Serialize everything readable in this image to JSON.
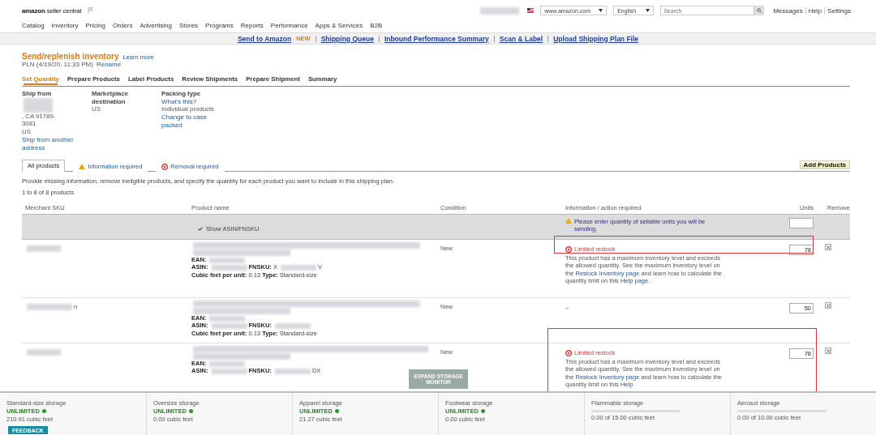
{
  "header": {
    "logo": {
      "brand": "amazon",
      "product": "seller central"
    },
    "marketplace": "www.amazon.com",
    "language": "English",
    "search_placeholder": "Search",
    "links": [
      "Messages",
      "Help",
      "Settings"
    ]
  },
  "nav": [
    "Catalog",
    "Inventory",
    "Pricing",
    "Orders",
    "Advertising",
    "Stores",
    "Programs",
    "Reports",
    "Performance",
    "Apps & Services",
    "B2B"
  ],
  "subnav": [
    {
      "label": "Send to Amazon",
      "badge": "NEW"
    },
    {
      "label": "Shipping Queue"
    },
    {
      "label": "Inbound Performance Summary"
    },
    {
      "label": "Scan & Label"
    },
    {
      "label": "Upload Shipping Plan File"
    }
  ],
  "page": {
    "title": "Send/replenish inventory",
    "learn_more": "Learn more",
    "plan": "PLN (4/19/20, 11:33 PM)",
    "rename": "Rename"
  },
  "steps": [
    {
      "label": "Set Quantity",
      "selected": true
    },
    {
      "label": "Prepare Products",
      "selected": false
    },
    {
      "label": "Label Products",
      "selected": false
    },
    {
      "label": "Review Shipments",
      "selected": false
    },
    {
      "label": "Prepare Shipment",
      "selected": false
    },
    {
      "label": "Summary",
      "selected": false
    }
  ],
  "ship_from": {
    "label": "Ship from",
    "address": [
      ", CA 91789-",
      "3081",
      "US"
    ],
    "link": "Ship from another address"
  },
  "marketplace": {
    "label": "Marketplace destination",
    "value": "US"
  },
  "packing": {
    "label": "Packing type",
    "help": "What's this?",
    "value": "Individual products",
    "link": "Change to case packed"
  },
  "filter_tabs": [
    {
      "label": "All products",
      "kind": "all",
      "selected": true
    },
    {
      "label": "Information required",
      "kind": "warning",
      "selected": false
    },
    {
      "label": "Removal required",
      "kind": "error",
      "selected": false
    }
  ],
  "add_button": "Add Products",
  "instructions": "Provide missing information, remove ineligible products, and specify the quantity for each product you want to include in this shipping plan.",
  "count": "1 to 8 of 8 products",
  "table": {
    "columns": [
      "Merchant SKU",
      "Product name",
      "Condition",
      "Information / action required",
      "Units",
      "Remove"
    ],
    "summary_row": {
      "toggle": "Show ASIN/FNSKU",
      "message": "Please enter quantity of sellable units you will be sending."
    },
    "rows": [
      {
        "condition": "New",
        "lines": [
          [
            {
              "kind": "label",
              "text": "EAN:"
            },
            {
              "kind": "redacted"
            }
          ],
          [
            {
              "kind": "label",
              "text": "ASIN:"
            },
            {
              "kind": "redacted"
            },
            {
              "kind": "label",
              "text": "FNSKU:"
            },
            {
              "kind": "value",
              "text": "X"
            },
            {
              "kind": "redacted"
            },
            {
              "kind": "value",
              "text": "V"
            }
          ],
          [
            {
              "kind": "label",
              "text": "Cubic feet per unit:"
            },
            {
              "kind": "value",
              "text": "0.13"
            },
            {
              "kind": "label",
              "text": "Type:"
            },
            {
              "kind": "value",
              "text": "Standard-size"
            }
          ]
        ],
        "info": {
          "kind": "error",
          "title": "Limited restock",
          "parts": [
            {
              "kind": "text",
              "text": "This product has a maximum inventory level and exceeds the allowed quantity. See the maximum inventory level on the "
            },
            {
              "kind": "link",
              "text": "Restock Inventory page"
            },
            {
              "kind": "text",
              "text": " and learn how to calculate the quantity limit on this "
            },
            {
              "kind": "link",
              "text": "Help page"
            },
            {
              "kind": "text",
              "text": "."
            }
          ]
        },
        "units": "78"
      },
      {
        "sku_tail": "n",
        "condition": "New",
        "lines": [
          [
            {
              "kind": "label",
              "text": "EAN:"
            },
            {
              "kind": "redacted"
            }
          ],
          [
            {
              "kind": "label",
              "text": "ASIN:"
            },
            {
              "kind": "redacted"
            },
            {
              "kind": "label",
              "text": "FNSKU:"
            },
            {
              "kind": "redacted"
            }
          ],
          [
            {
              "kind": "label",
              "text": "Cubic feet per unit:"
            },
            {
              "kind": "value",
              "text": "0.13"
            },
            {
              "kind": "label",
              "text": "Type:"
            },
            {
              "kind": "value",
              "text": "Standard-size"
            }
          ]
        ],
        "info": {
          "kind": "none",
          "title": "–"
        },
        "units": "50"
      },
      {
        "condition": "New",
        "lines": [
          [
            {
              "kind": "label",
              "text": "EAN:"
            },
            {
              "kind": "redacted"
            }
          ],
          [
            {
              "kind": "label",
              "text": "ASIN:"
            },
            {
              "kind": "redacted"
            },
            {
              "kind": "label",
              "text": "FNSKU:"
            },
            {
              "kind": "redacted"
            },
            {
              "kind": "value",
              "text": "DX"
            }
          ]
        ],
        "info": {
          "kind": "error",
          "title": "Limited restock",
          "parts": [
            {
              "kind": "text",
              "text": "This product has a maximum inventory level and exceeds the allowed quantity. See the maximum inventory level on the "
            },
            {
              "kind": "link",
              "text": "Restock Inventory page"
            },
            {
              "kind": "text",
              "text": " and learn how to calculate the quantity limit on this "
            },
            {
              "kind": "link",
              "text": "Help"
            }
          ]
        },
        "units": "78"
      }
    ]
  },
  "expand_button": "EXPAND STORAGE MONITOR",
  "storage": [
    {
      "kind": "unlimited",
      "label": "Standard-size storage",
      "status": "UNLIMITED",
      "value": "210.91 cubic feet"
    },
    {
      "kind": "unlimited",
      "label": "Oversize storage",
      "status": "UNLIMITED",
      "value": "0.00 cubic feet"
    },
    {
      "kind": "unlimited",
      "label": "Apparel storage",
      "status": "UNLIMITED",
      "value": "21.27 cubic feet"
    },
    {
      "kind": "unlimited",
      "label": "Footwear storage",
      "status": "UNLIMITED",
      "value": "0.00 cubic feet"
    },
    {
      "kind": "limited",
      "label": "Flammable storage",
      "level": 0,
      "value": "0.00 of 15.00 cubic feet"
    },
    {
      "kind": "limited",
      "label": "Aerosol storage",
      "level": 0,
      "value": "0.00 of 10.00 cubic feet"
    }
  ],
  "feedback": "FEEDBACK"
}
